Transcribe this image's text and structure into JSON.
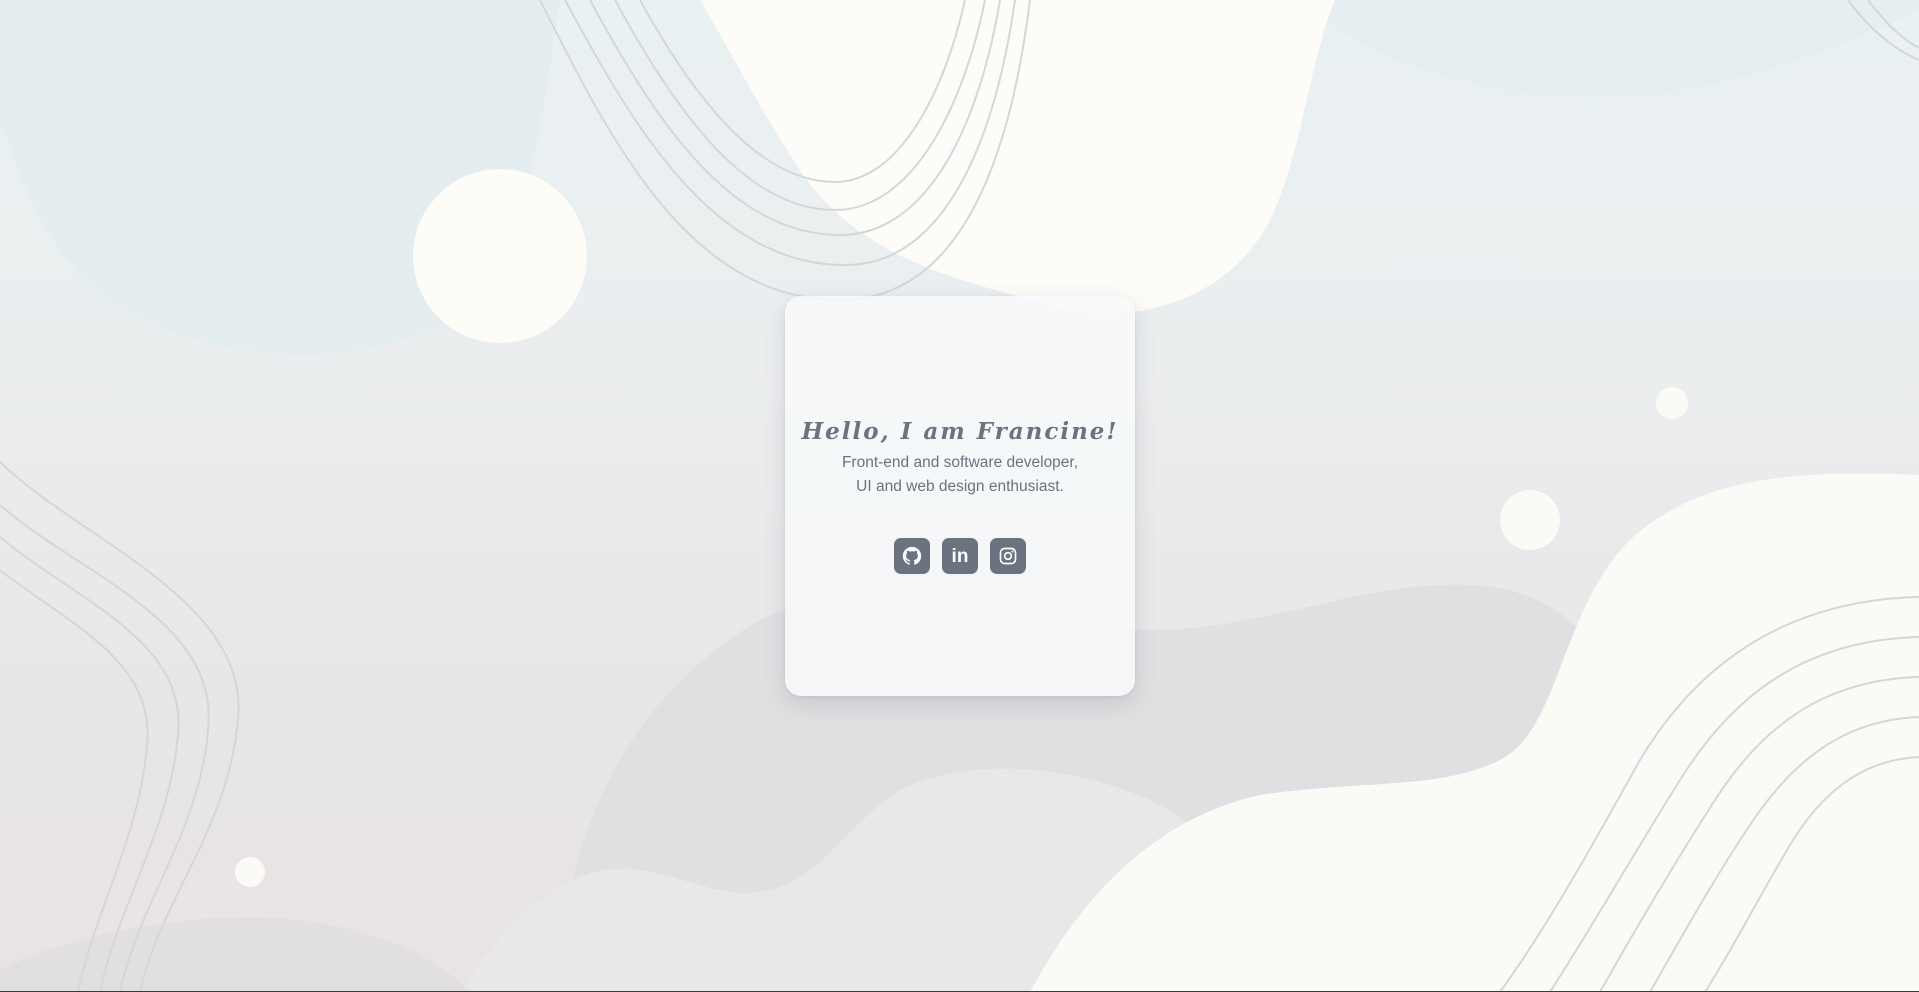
{
  "profile": {
    "greeting": "Hello, I am Francine!",
    "tagline_line1": "Front-end and software developer,",
    "tagline_line2": "UI and web design enthusiast."
  },
  "socials": [
    {
      "name": "GitHub",
      "icon": "github-icon",
      "glyph": ""
    },
    {
      "name": "LinkedIn",
      "icon": "linkedin-icon",
      "glyph": "in"
    },
    {
      "name": "Instagram",
      "icon": "instagram-icon",
      "glyph": ""
    }
  ],
  "colors": {
    "text": "#6b7280",
    "icon_bg": "#6b7280",
    "card_bg": "#f8fafb",
    "blob_cream": "#fdfcf8",
    "blob_blue": "#e6eff2",
    "blob_gray": "#dcdcdf",
    "line": "#d4d4d6"
  }
}
